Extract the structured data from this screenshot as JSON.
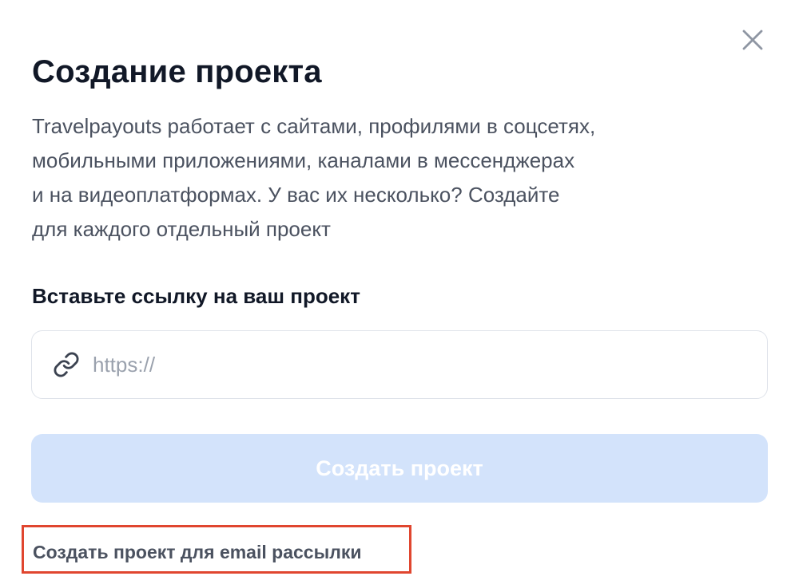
{
  "modal": {
    "close_icon": "close-icon",
    "title": "Создание проекта",
    "description_lines": [
      "Travelpayouts работает с сайтами, профилями в соцсетях,",
      "мобильными приложениями, каналами в мессенджерах",
      "и на видеоплатформах. У вас их несколько? Создайте",
      "для каждого отдельный проект"
    ],
    "field_label": "Вставьте ссылку на ваш проект",
    "url_input": {
      "value": "",
      "placeholder": "https://",
      "icon": "link-icon"
    },
    "create_button_label": "Создать проект",
    "create_button_state": "disabled",
    "email_project_link": "Создать проект для email рассылки"
  },
  "colors": {
    "title": "#111827",
    "body_text": "#4b5260",
    "button_disabled_bg": "#d3e3fb",
    "button_text": "#ffffff",
    "input_border": "#dfe3ea",
    "highlight_border": "#e0462f"
  }
}
